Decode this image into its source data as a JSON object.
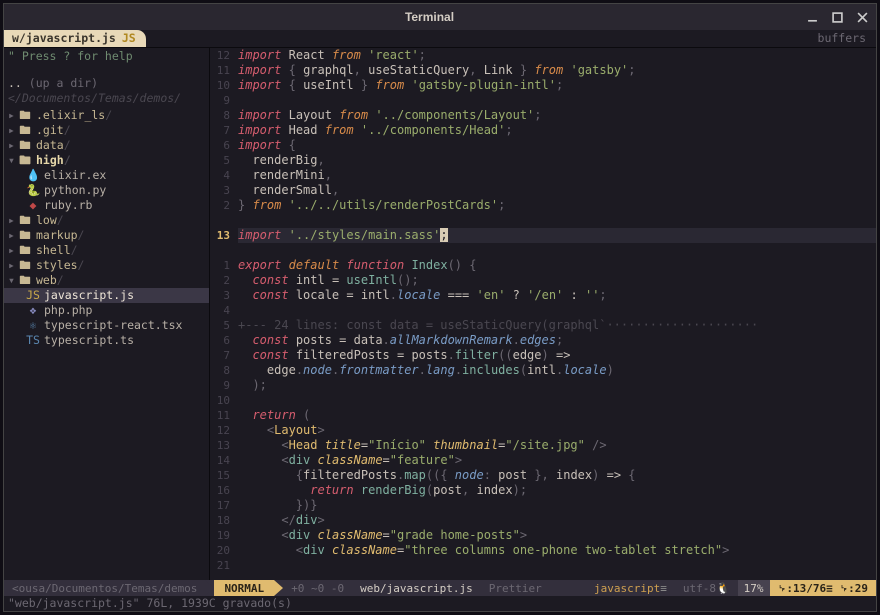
{
  "window": {
    "title": "Terminal"
  },
  "tabline": {
    "active_tab": {
      "label": "w/javascript.js",
      "filetype_badge": "JS"
    },
    "buffers_label": "buffers"
  },
  "sidebar": {
    "help_hint": "\" Press ? for help",
    "up_dir": ".. (up a dir)",
    "path": "</Documentos/Temas/demos/",
    "tree": [
      {
        "depth": 0,
        "kind": "folder",
        "name": ".elixir_ls",
        "open": false
      },
      {
        "depth": 0,
        "kind": "folder",
        "name": ".git",
        "open": false
      },
      {
        "depth": 0,
        "kind": "folder",
        "name": "data",
        "open": false
      },
      {
        "depth": 0,
        "kind": "folder",
        "name": "high",
        "open": true,
        "highlight": true
      },
      {
        "depth": 1,
        "kind": "file",
        "name": "elixir.ex",
        "icon": "ex"
      },
      {
        "depth": 1,
        "kind": "file",
        "name": "python.py",
        "icon": "py"
      },
      {
        "depth": 1,
        "kind": "file",
        "name": "ruby.rb",
        "icon": "rb"
      },
      {
        "depth": 0,
        "kind": "folder",
        "name": "low",
        "open": false
      },
      {
        "depth": 0,
        "kind": "folder",
        "name": "markup",
        "open": false
      },
      {
        "depth": 0,
        "kind": "folder",
        "name": "shell",
        "open": false
      },
      {
        "depth": 0,
        "kind": "folder",
        "name": "styles",
        "open": false
      },
      {
        "depth": 0,
        "kind": "folder",
        "name": "web",
        "open": true
      },
      {
        "depth": 1,
        "kind": "file",
        "name": "javascript.js",
        "icon": "js",
        "selected": true
      },
      {
        "depth": 1,
        "kind": "file",
        "name": "php.php",
        "icon": "php"
      },
      {
        "depth": 1,
        "kind": "file",
        "name": "typescript-react.tsx",
        "icon": "tsx"
      },
      {
        "depth": 1,
        "kind": "file",
        "name": "typescript.ts",
        "icon": "ts"
      }
    ]
  },
  "editor": {
    "cursor_line_gutter": "13",
    "gutter_numbers": [
      "12",
      "11",
      "10",
      "9",
      "8",
      "7",
      "6",
      "5",
      "4",
      "3",
      "2",
      "",
      "13",
      "",
      "1",
      "2",
      "3",
      "4",
      "5",
      "6",
      "7",
      "8",
      "9",
      "10",
      "11",
      "12",
      "13",
      "14",
      "15",
      "16",
      "17",
      "18",
      "19",
      "20",
      "21"
    ],
    "fold_text": "+--- 24 lines: const data = useStaticQuery(graphql`·····················",
    "strings": {
      "react": "'react'",
      "gatsby": "'gatsby'",
      "gatsby_plugin_intl": "'gatsby-plugin-intl'",
      "layout_path": "'../components/Layout'",
      "head_path": "'../components/Head'",
      "render_path": "'../../utils/renderPostCards'",
      "sass_path": "'../styles/main.sass'",
      "en": "'en'",
      "en_slash": "'/en'",
      "empty": "''",
      "title": "\"Início\"",
      "thumb": "\"/site.jpg\"",
      "feature": "\"feature\"",
      "grade": "\"grade home-posts\"",
      "cols": "\"three columns one-phone two-tablet stretch\""
    }
  },
  "statusline": {
    "left_path": "<ousa/Documentos/Temas/demos",
    "mode": "NORMAL",
    "git": "+0 ~0 -0",
    "file": "web/javascript.js",
    "linter": "Prettier",
    "filetype": "javascript",
    "encoding": "utf-8",
    "percent": "17%",
    "pos": "␊:13/76≡ ␊:29"
  },
  "messages": {
    "line": "\"web/javascript.js\" 76L, 1939C gravado(s)"
  }
}
